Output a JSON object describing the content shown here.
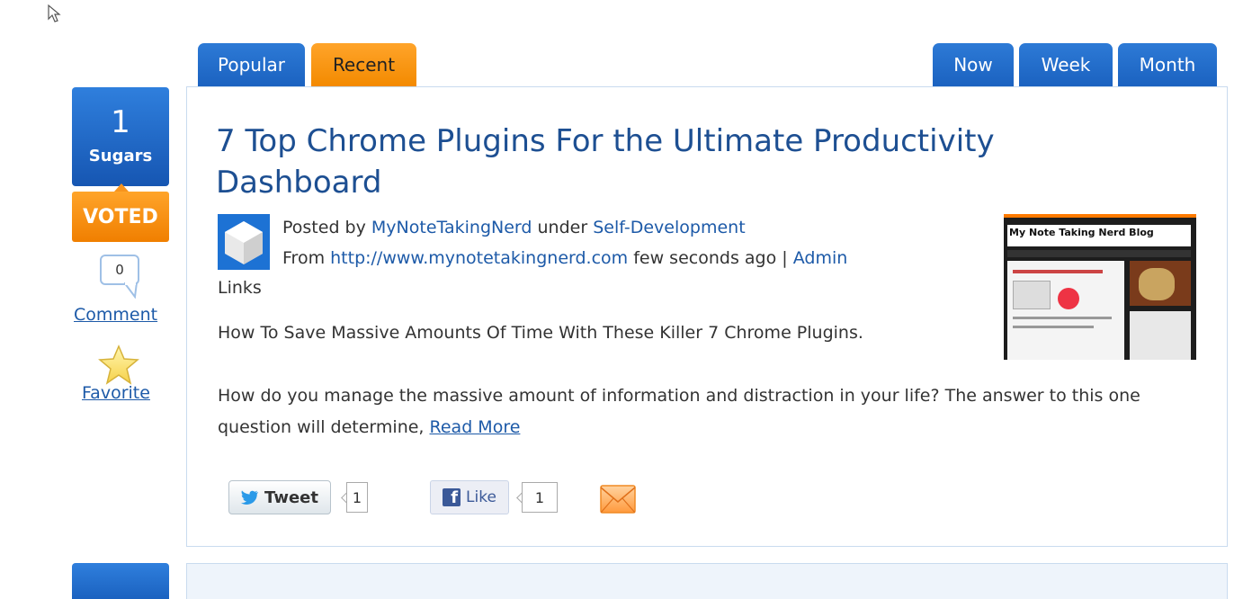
{
  "tabs": {
    "popular": "Popular",
    "recent": "Recent",
    "now": "Now",
    "week": "Week",
    "month": "Month"
  },
  "vote": {
    "count": "1",
    "unit": "Sugars",
    "voted_label": "VOTED"
  },
  "comment": {
    "count": "0",
    "label": "Comment"
  },
  "favorite": {
    "label": "Favorite"
  },
  "story": {
    "title": "7 Top Chrome Plugins For the Ultimate Productivity Dashboard",
    "posted_by_prefix": "Posted by",
    "author": "MyNoteTakingNerd",
    "under": "under",
    "category": "Self-Development",
    "from_prefix": "From",
    "source_url": "http://www.mynotetakingnerd.com",
    "time_ago": "few seconds ago",
    "separator": "|",
    "admin_links": "Admin",
    "admin_links_cont": "Links",
    "excerpt": "How To Save Massive Amounts Of Time With These Killer 7 Chrome Plugins.",
    "description": "How do you manage the massive amount of information and distraction in your life? The answer to this one question will determine,",
    "read_more": "Read More",
    "thumbnail_title": "My Note Taking Nerd Blog"
  },
  "share": {
    "tweet_label": "Tweet",
    "tweet_count": "1",
    "like_label": "Like",
    "like_count": "1"
  },
  "colors": {
    "tab_blue": "#1b62c0",
    "tab_orange": "#f38a00",
    "link": "#1d5aa8",
    "title": "#1d4f92"
  },
  "icons": [
    "cursor-icon",
    "comment-bubble-icon",
    "star-icon",
    "twitter-bird-icon",
    "facebook-icon",
    "email-icon"
  ]
}
